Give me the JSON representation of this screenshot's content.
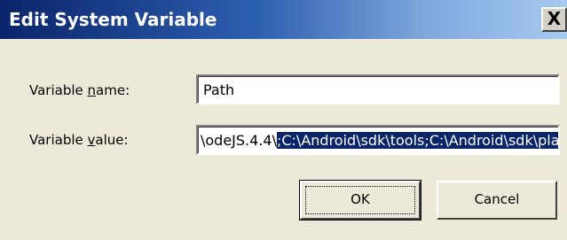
{
  "window": {
    "title": "Edit System Variable",
    "close_label": "X"
  },
  "form": {
    "name_label_pre": "Variable ",
    "name_label_accel": "n",
    "name_label_post": "ame:",
    "value_label_pre": "Variable ",
    "value_label_accel": "v",
    "value_label_post": "alue:",
    "name_value": "Path",
    "value_text_unselected": "\\odeJS.4.4\\",
    "value_text_selected": ";C:\\Android\\sdk\\tools;C:\\Android\\sdk\\platform-tools"
  },
  "buttons": {
    "ok_label": "OK",
    "cancel_label": "Cancel"
  },
  "colors": {
    "title_bar_start": "#0a246a",
    "title_bar_end": "#a6caf0",
    "dialog_bg": "#ece9d8",
    "selection_bg": "#0a246a",
    "selection_fg": "#ffffff"
  }
}
